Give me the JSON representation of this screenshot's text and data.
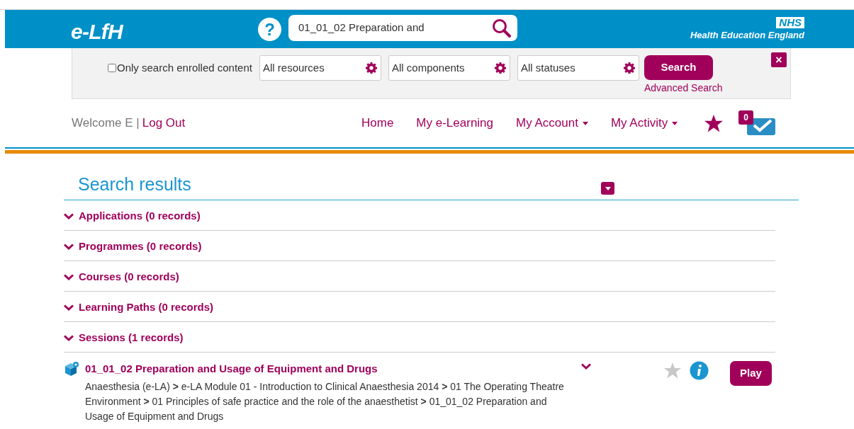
{
  "header": {
    "logo": "e-LfH",
    "help": "?",
    "search_value": "01_01_02 Preparation and",
    "brand_badge": "NHS",
    "brand_name": "Health Education England"
  },
  "filters": {
    "enrolled_only": {
      "label": "Only search enrolled content",
      "checked": false
    },
    "selects": [
      "All resources",
      "All components",
      "All statuses"
    ],
    "search_button": "Search",
    "advanced_link": "Advanced Search",
    "close": "×"
  },
  "nav": {
    "welcome": "Welcome E |",
    "logout": "Log Out",
    "items": [
      {
        "label": "Home",
        "dropdown": false
      },
      {
        "label": "My e-Learning",
        "dropdown": false
      },
      {
        "label": "My Account",
        "dropdown": true
      },
      {
        "label": "My Activity",
        "dropdown": true
      }
    ],
    "message_count": "0"
  },
  "results": {
    "title": "Search results",
    "sections": [
      {
        "label": "Applications (0 records)"
      },
      {
        "label": "Programmes (0 records)"
      },
      {
        "label": "Courses (0 records)"
      },
      {
        "label": "Learning Paths (0 records)"
      },
      {
        "label": "Sessions (1 records)"
      }
    ],
    "items": [
      {
        "title": "01_01_02 Preparation and Usage of Equipment and Drugs",
        "path": "Anaesthesia (e-LA) **>** e-LA Module 01 - Introduction to Clinical Anaesthesia 2014 **>** 01 The Operating Theatre Environment **>** 01 Principles of safe practice and the role of the anaesthetist **>** 01_01_02 Preparation and Usage of Equipment and Drugs",
        "favourite": false,
        "play": "Play"
      }
    ]
  }
}
